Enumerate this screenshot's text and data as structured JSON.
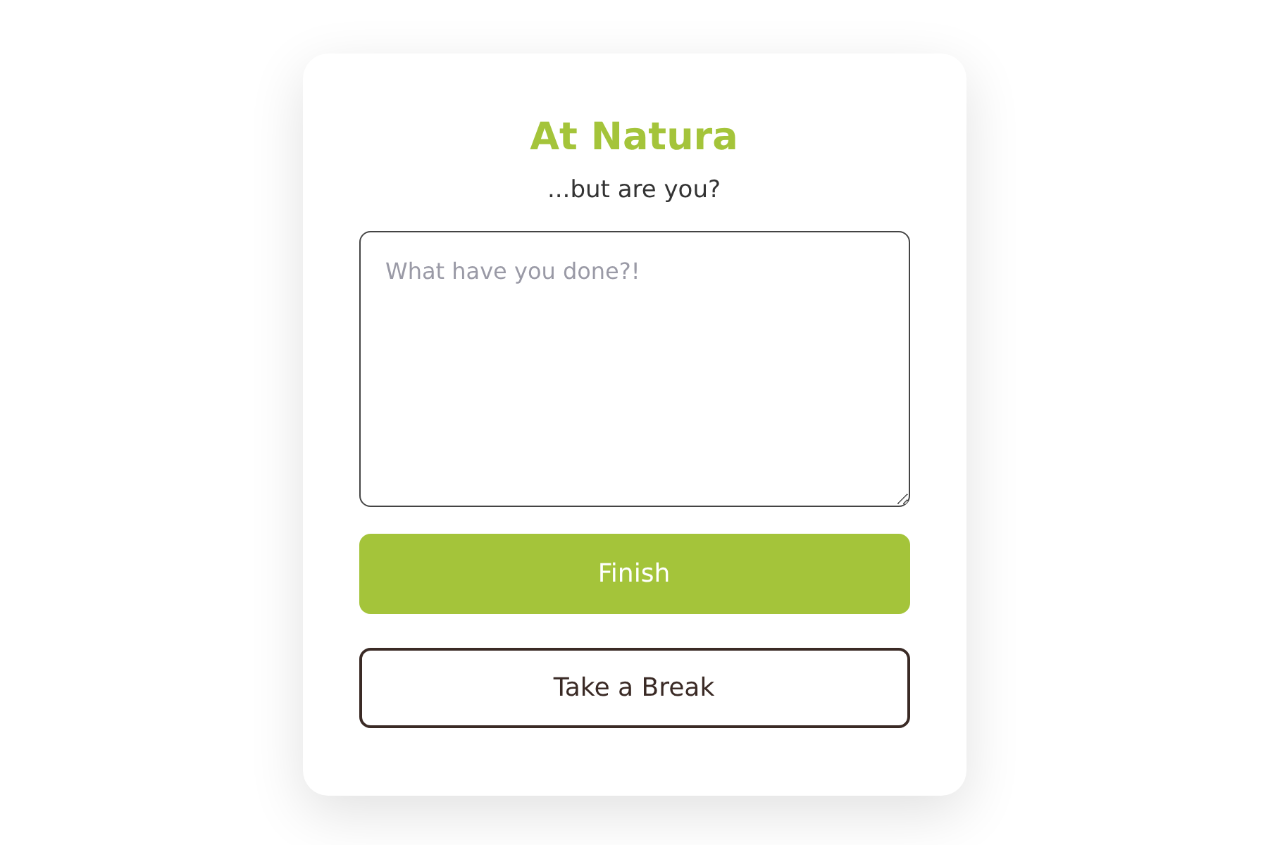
{
  "card": {
    "title": "At Natura",
    "subtitle": "...but are you?",
    "entry": {
      "placeholder": "What have you done?!"
    },
    "buttons": [
      {
        "label": "Finish",
        "kind": "primary"
      },
      {
        "label": "Take a Break",
        "kind": "outline"
      }
    ]
  }
}
